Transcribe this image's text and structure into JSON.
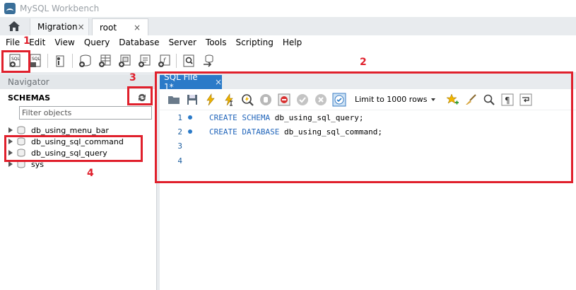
{
  "window": {
    "title": "MySQL Workbench",
    "icon": "workbench-dolphin-icon"
  },
  "connection_tabs": [
    {
      "label": "Migration",
      "close": "×"
    },
    {
      "label": "root",
      "close": "×"
    }
  ],
  "menu": [
    "File",
    "Edit",
    "View",
    "Query",
    "Database",
    "Server",
    "Tools",
    "Scripting",
    "Help"
  ],
  "main_toolbar": {
    "icons": [
      "new-sql-tab-icon",
      "open-sql-file-icon",
      "inspector-icon",
      "create-schema-icon",
      "create-table-icon",
      "create-view-icon",
      "create-procedure-icon",
      "create-function-icon",
      "search-table-data-icon",
      "reconnect-icon"
    ]
  },
  "navigator": {
    "header": "Navigator",
    "schemas_label": "SCHEMAS",
    "filter_placeholder": "Filter objects",
    "schemas": [
      "db_using_menu_bar",
      "db_using_sql_command",
      "db_using_sql_query",
      "sys"
    ]
  },
  "editor": {
    "tab_label": "SQL File 1*",
    "tab_close": "×",
    "limit_label": "Limit to 1000 rows",
    "lines": [
      {
        "num": "1",
        "kw": "CREATE SCHEMA",
        "rest": " db_using_sql_query;"
      },
      {
        "num": "2",
        "kw": "CREATE DATABASE",
        "rest": " db_using_sql_command;"
      },
      {
        "num": "3",
        "kw": "",
        "rest": ""
      },
      {
        "num": "4",
        "kw": "",
        "rest": ""
      }
    ]
  },
  "annotations": [
    "1",
    "2",
    "3",
    "4"
  ],
  "colors": {
    "annotation": "#e0202c",
    "active_tab": "#2a7ac8",
    "keyword": "#2266bb"
  }
}
